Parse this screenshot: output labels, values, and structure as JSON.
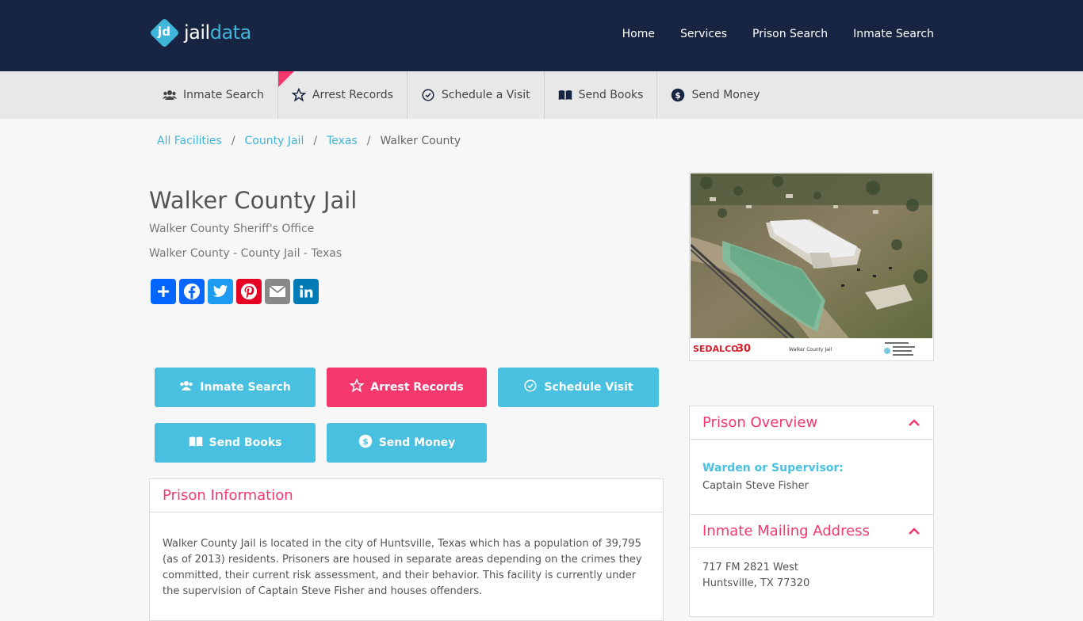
{
  "header": {
    "logo_prefix": "jail",
    "logo_suffix": "data",
    "logo_badge": "jd",
    "nav": [
      "Home",
      "Services",
      "Prison Search",
      "Inmate Search"
    ]
  },
  "subnav": [
    {
      "label": "Inmate Search",
      "icon": "users-icon"
    },
    {
      "label": "Arrest Records",
      "icon": "star-icon"
    },
    {
      "label": "Schedule a Visit",
      "icon": "clock-icon"
    },
    {
      "label": "Send Books",
      "icon": "book-icon"
    },
    {
      "label": "Send Money",
      "icon": "dollar-icon"
    }
  ],
  "breadcrumb": {
    "items": [
      "All Facilities",
      "County Jail",
      "Texas"
    ],
    "current": "Walker County",
    "separator": "/"
  },
  "facility": {
    "title": "Walker County Jail",
    "agency": "Walker County Sheriff's Office",
    "category": "Walker County - County Jail - Texas"
  },
  "share": {
    "icons": [
      "share-plus-icon",
      "facebook-icon",
      "twitter-icon",
      "pinterest-icon",
      "email-icon",
      "linkedin-icon"
    ]
  },
  "actions": {
    "inmate_search": "Inmate Search",
    "arrest_records": "Arrest Records",
    "schedule_visit": "Schedule Visit",
    "send_books": "Send Books",
    "send_money": "Send Money"
  },
  "prison_info": {
    "heading": "Prison Information",
    "body": "Walker County Jail is located in the city of Huntsville, Texas which has a population of 39,795 (as of 2013) residents. Prisoners are housed in separate areas depending on the crimes they committed, their current risk assessment, and their behavior. This facility is currently under the supervision of Captain Steve Fisher and houses offenders."
  },
  "photo": {
    "brand": "SEDALCO",
    "brand_number": "30",
    "caption": "Walker County Jail"
  },
  "overview": {
    "heading": "Prison Overview",
    "warden_label": "Warden or Supervisor:",
    "warden_name": "Captain Steve Fisher"
  },
  "mailing": {
    "heading": "Inmate Mailing Address",
    "line1": "717 FM 2821 West",
    "line2": "Huntsville, TX 77320"
  },
  "colors": {
    "navy": "#182542",
    "accent_blue": "#4ac0e0",
    "accent_pink": "#f3386d"
  }
}
